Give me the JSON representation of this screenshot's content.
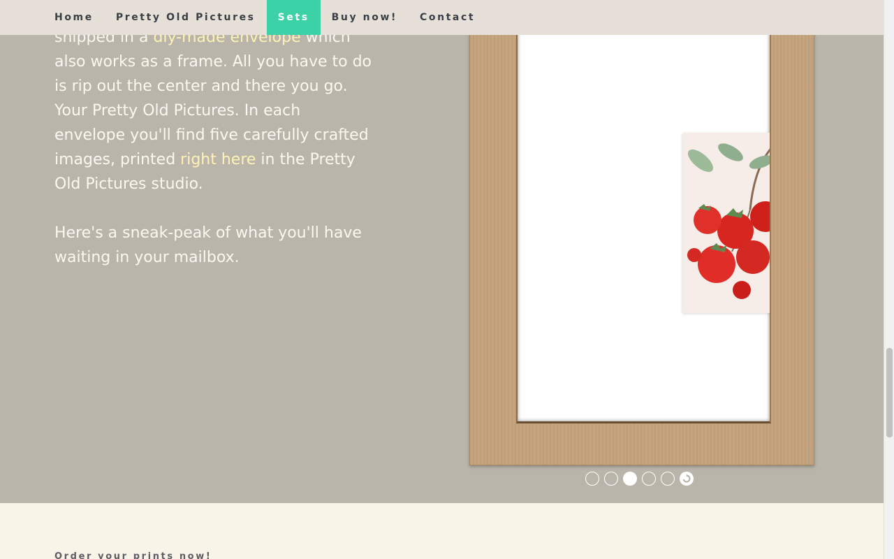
{
  "nav": {
    "items": [
      {
        "label": "Home"
      },
      {
        "label": "Pretty Old Pictures"
      },
      {
        "label": "Sets"
      },
      {
        "label": "Buy now!"
      },
      {
        "label": "Contact"
      }
    ],
    "active": "Sets"
  },
  "copy": {
    "p1_part1": "shipped in a ",
    "p1_link1": "diy-made envelope",
    "p1_part2": " which also works as a frame. All you have to do is rip out the center and there you go. Your Pretty Old Pictures. In each envelope you'll find five carefully crafted images, printed ",
    "p1_link2": "right here",
    "p1_part3": " in the Pretty Old Pictures studio.",
    "p2": "Here's a sneak-peak of what you'll have waiting in your mailbox."
  },
  "slider": {
    "slide_count": 5,
    "active_index": 3
  },
  "bottom": {
    "title": "Order your prints now!"
  },
  "colors": {
    "nav_bg": "#e7e0d8",
    "nav_active": "#3bd2a8",
    "page_bg": "#b9b5aa",
    "link": "#fff2b6",
    "cardboard": "#c4a27d",
    "bottom_bg": "#f9f4e8"
  }
}
